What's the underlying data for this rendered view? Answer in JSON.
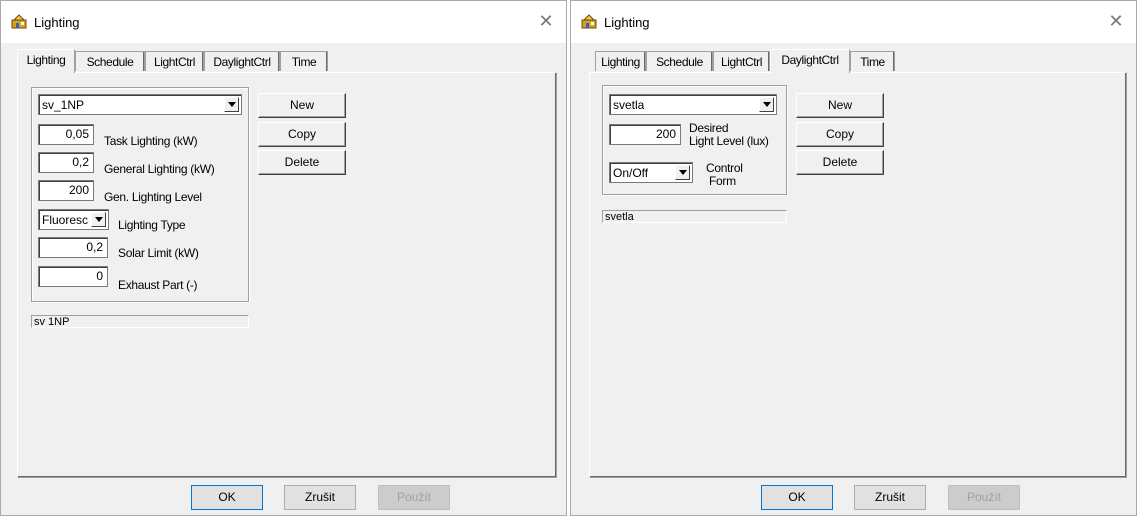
{
  "window1": {
    "title": "Lighting",
    "tabs": [
      "Lighting",
      "Schedule",
      "LightCtrl",
      "DaylightCtrl",
      "Time"
    ],
    "active_tab": "Lighting",
    "selector": "sv_1NP",
    "fields": [
      {
        "value": "0,05",
        "label": "Task Lighting (kW)"
      },
      {
        "value": "0,2",
        "label": "General Lighting (kW)"
      },
      {
        "value": "200",
        "label": "Gen. Lighting Level"
      },
      {
        "value": "0,2",
        "label": "Solar Limit (kW)"
      },
      {
        "value": "0",
        "label": "Exhaust Part (-)"
      }
    ],
    "lighting_type": {
      "value": "Fluoresc",
      "label": "Lighting Type"
    },
    "buttons": {
      "new": "New",
      "copy": "Copy",
      "delete": "Delete"
    },
    "status": "sv  1NP",
    "dialog": {
      "ok": "OK",
      "cancel": "Zrušit",
      "apply": "Použít"
    }
  },
  "window2": {
    "title": "Lighting",
    "tabs": [
      "Lighting",
      "Schedule",
      "LightCtrl",
      "DaylightCtrl",
      "Time"
    ],
    "active_tab": "DaylightCtrl",
    "selector": "svetla",
    "level": {
      "value": "200",
      "label_line1": "Desired",
      "label_line2": "Light Level (lux)"
    },
    "control": {
      "value": "On/Off",
      "label_line1": "Control",
      "label_line2": "Form"
    },
    "buttons": {
      "new": "New",
      "copy": "Copy",
      "delete": "Delete"
    },
    "status": "svetla",
    "dialog": {
      "ok": "OK",
      "cancel": "Zrušit",
      "apply": "Použít"
    }
  }
}
